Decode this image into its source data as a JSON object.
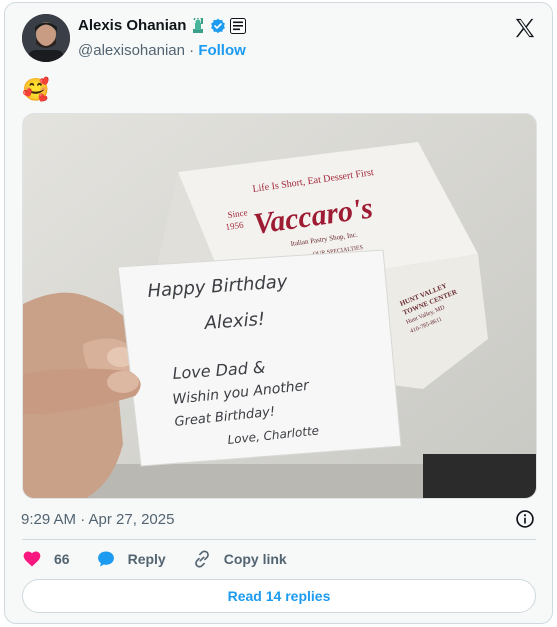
{
  "tweet": {
    "author_name": "Alexis Ohanian",
    "handle": "@alexisohanian",
    "separator": " · ",
    "follow_label": "Follow",
    "emoji": "🥰",
    "timestamp": "9:29 AM · Apr 27, 2025"
  },
  "photo": {
    "box": {
      "tagline": "Life Is Short, Eat Dessert First",
      "since": "Since",
      "year": "1956",
      "brand": "Vaccaro's",
      "subtitle": "Italian Pastry Shop, Inc.",
      "specialties": "OUR SPECIALTIES",
      "location_1": "HUNT VALLEY",
      "location_2": "TOWNE CENTER",
      "location_3": "Hunt Valley, MD",
      "phone": "410-785-8611"
    },
    "note_lines": [
      "Happy Birthday",
      "Alexis!",
      "Love Dad &",
      "Wishin you Another",
      "Great Birthday!",
      "Love, Charlotte"
    ]
  },
  "actions": {
    "likes_count": "66",
    "reply_label": "Reply",
    "copy_link_label": "Copy link"
  },
  "footer": {
    "read_replies_label": "Read 14 replies"
  },
  "colors": {
    "accent": "#1d9bf0",
    "like": "#f91880",
    "muted": "#536471",
    "verified": "#1d9bf0"
  }
}
